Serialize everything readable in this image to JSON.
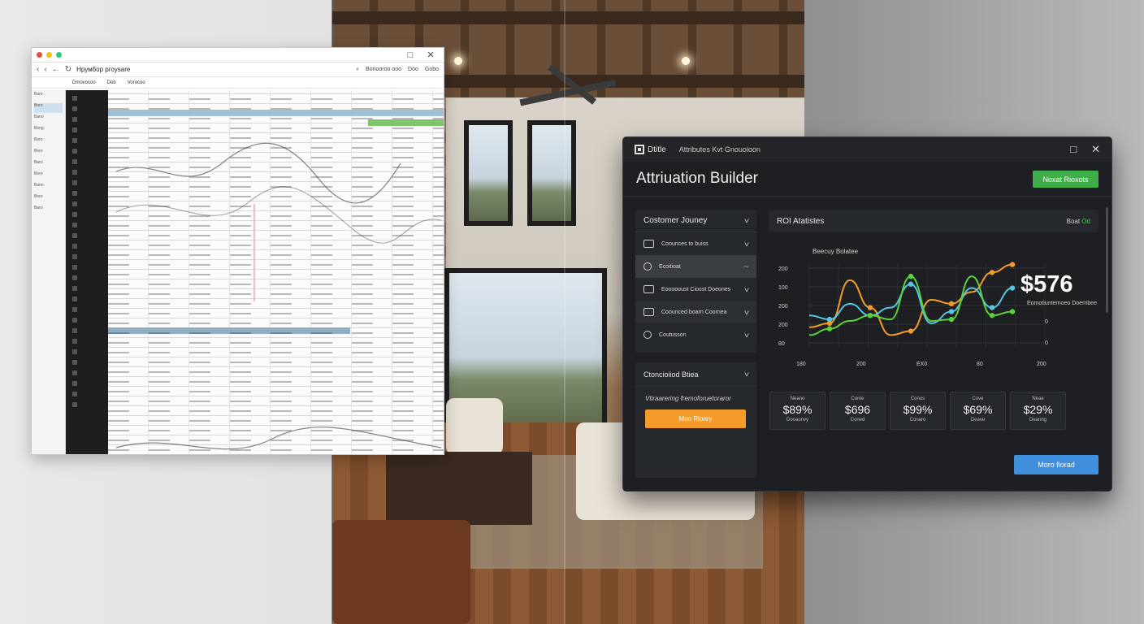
{
  "spreadsheet": {
    "url": "Нрумбор ргоуsare",
    "tools": [
      "Bonooroo ooo",
      "Doo",
      "Gobo"
    ],
    "ribbon": [
      "Dmovocoo",
      "Dob",
      "Vorocoo"
    ],
    "sidebar_rows": [
      "Baro",
      "Boro",
      "Bano",
      "Bong",
      "Boro",
      "Boro",
      "Baro",
      "Boro",
      "Bano",
      "Boro",
      "Baro"
    ],
    "window_controls": [
      "□",
      "✕"
    ]
  },
  "dashboard": {
    "app_name": "Dtitle",
    "menu_text": "Attributes Kvt Gnouoioon",
    "window_controls": [
      "□",
      "✕"
    ],
    "title": "Attriuation Builder",
    "next_button": "Noxat Rioxots",
    "customer_journey": {
      "title": "Costomer Jouney",
      "items": [
        {
          "label": "Coounces to buiss",
          "icon": "card-icon"
        },
        {
          "label": "Ecoitioat",
          "icon": "link-icon"
        },
        {
          "label": "Eoooooust Cioost Doeones",
          "icon": "chart-icon"
        },
        {
          "label": "Coounced boarn Coornea",
          "icon": "display-icon"
        },
        {
          "label": "Coutusson",
          "icon": "bulb-icon"
        }
      ]
    },
    "channel_panel": {
      "title": "Ctoncioiiod Btiea",
      "description": "Vtiraarering fremoforuetoraror",
      "button": "Moo Rionry"
    },
    "roi": {
      "title": "ROI Atatistes",
      "right_prefix": "Boat",
      "right_status": "Od"
    },
    "big_value": "$576",
    "big_sub": "Eomotiunternoeo Doerribee",
    "metrics": [
      {
        "label": "Neano",
        "value": "$89%",
        "sub": "Dooaunvy"
      },
      {
        "label": "Conte",
        "value": "$696",
        "sub": "Coned"
      },
      {
        "label": "Conos",
        "value": "$99%",
        "sub": "Conaro"
      },
      {
        "label": "Cove",
        "value": "$69%",
        "sub": "Deave"
      },
      {
        "label": "Neae",
        "value": "$29%",
        "sub": "Deanng"
      }
    ],
    "more_button": "Moro fiorad"
  },
  "chart_data": {
    "type": "line",
    "title": "Beecuy Bolatee",
    "y_tick_labels": [
      "200",
      "100",
      "200",
      "200",
      "80"
    ],
    "x_tick_labels": [
      "180",
      "200",
      "EX0",
      "80",
      "200"
    ],
    "right_tick_labels": [
      "0",
      "0"
    ],
    "x": [
      0,
      1,
      2,
      3,
      4,
      5,
      6,
      7,
      8,
      9,
      10
    ],
    "series": [
      {
        "name": "",
        "color": "#f59b2a",
        "values": [
          20,
          25,
          80,
          45,
          10,
          15,
          55,
          50,
          65,
          90,
          100
        ]
      },
      {
        "name": "",
        "color": "#57c4e0",
        "values": [
          35,
          30,
          50,
          35,
          45,
          75,
          25,
          40,
          70,
          45,
          70
        ]
      },
      {
        "name": "",
        "color": "#59d23c",
        "values": [
          10,
          18,
          28,
          35,
          30,
          85,
          28,
          30,
          85,
          35,
          40
        ]
      }
    ],
    "ylim": [
      0,
      110
    ],
    "grid": true
  }
}
